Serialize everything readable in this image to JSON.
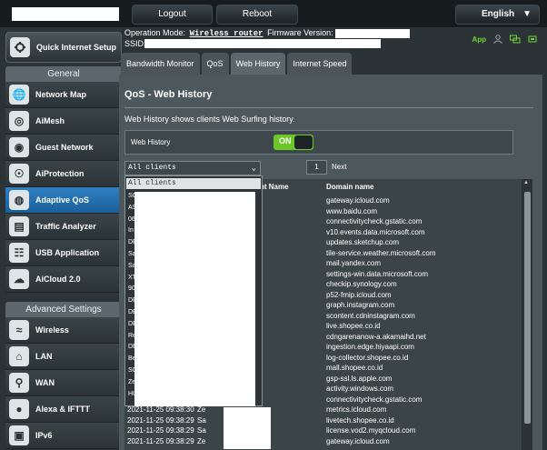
{
  "topbar": {
    "logout_label": "Logout",
    "reboot_label": "Reboot",
    "language": "English"
  },
  "status": {
    "operation_mode_label": "Operation Mode:",
    "operation_mode_value": "Wireless router",
    "firmware_label": "Firmware Version:",
    "ssid_label": "SSID:",
    "app_label": "App"
  },
  "sidebar": {
    "quick_setup_label": "Quick Internet Setup",
    "general_header": "General",
    "general_items": [
      {
        "label": "Network Map",
        "icon": "network-map-icon"
      },
      {
        "label": "AiMesh",
        "icon": "aimesh-icon"
      },
      {
        "label": "Guest Network",
        "icon": "guest-network-icon"
      },
      {
        "label": "AiProtection",
        "icon": "aiprotection-icon"
      },
      {
        "label": "Adaptive QoS",
        "icon": "adaptive-qos-icon"
      },
      {
        "label": "Traffic Analyzer",
        "icon": "traffic-analyzer-icon"
      },
      {
        "label": "USB Application",
        "icon": "usb-application-icon"
      },
      {
        "label": "AiCloud 2.0",
        "icon": "aicloud-icon"
      }
    ],
    "advanced_header": "Advanced Settings",
    "advanced_items": [
      {
        "label": "Wireless",
        "icon": "wireless-icon"
      },
      {
        "label": "LAN",
        "icon": "lan-icon"
      },
      {
        "label": "WAN",
        "icon": "wan-icon"
      },
      {
        "label": "Alexa & IFTTT",
        "icon": "alexa-icon"
      },
      {
        "label": "IPv6",
        "icon": "ipv6-icon"
      }
    ],
    "active_item": "Adaptive QoS"
  },
  "tabs": [
    "Bandwidth Monitor",
    "QoS",
    "Web History",
    "Internet Speed"
  ],
  "active_tab": "Web History",
  "main": {
    "title": "QoS - Web History",
    "description": "Web History shows clients Web Surfing history.",
    "toggle_label": "Web History",
    "toggle_state": "ON",
    "client_filter": "All clients",
    "page_number": "1",
    "next_label": "Next",
    "columns": {
      "client": "nt Name",
      "domain": "Domain name"
    }
  },
  "dropdown": {
    "selected": "All clients",
    "visible_prefixes": [
      "SO",
      "AS",
      "06",
      "In",
      "DE",
      "Sa",
      "Sa",
      "XT",
      "90",
      "DE",
      "DE",
      "DE",
      "Re",
      "DE",
      "Be",
      "SC",
      "Ze",
      "HU"
    ]
  },
  "rows": [
    {
      "time": "",
      "client": "",
      "domain": "gateway.icloud.com"
    },
    {
      "time": "",
      "client": "",
      "domain": "www.baidu.com"
    },
    {
      "time": "",
      "client": "",
      "domain": "connectivitycheck.gstatic.com"
    },
    {
      "time": "",
      "client": "YS",
      "domain": "v10.events.data.microsoft.com"
    },
    {
      "time": "",
      "client": "KE",
      "domain": "updates.sketchup.com"
    },
    {
      "time": "",
      "client": "",
      "domain": "tile-service.weather.microsoft.com"
    },
    {
      "time": "",
      "client": "",
      "domain": "mail.yandex.com"
    },
    {
      "time": "",
      "client": "",
      "domain": "settings-win.data.microsoft.com"
    },
    {
      "time": "",
      "client": "",
      "domain": "checkip.synology.com"
    },
    {
      "time": "",
      "client": "",
      "domain": "p52-fmip.icloud.com"
    },
    {
      "time": "",
      "client": "",
      "domain": "graph.instagram.com"
    },
    {
      "time": "",
      "client": "",
      "domain": "scontent.cdninstagram.com"
    },
    {
      "time": "",
      "client": "9",
      "domain": "live.shopee.co.id"
    },
    {
      "time": "",
      "client": "9",
      "domain": "cdngarenanow-a.akamaihd.net"
    },
    {
      "time": "",
      "client": "9",
      "domain": "ingestion.edge.hiyaapi.com"
    },
    {
      "time": "",
      "client": "9",
      "domain": "log-collector.shopee.co.id"
    },
    {
      "time": "",
      "client": "9",
      "domain": "mall.shopee.co.id"
    },
    {
      "time": "",
      "client": "",
      "domain": "gsp-ssl.ls.apple.com"
    },
    {
      "time": "",
      "client": "U",
      "domain": "activity.windows.com"
    },
    {
      "time": "",
      "client": "",
      "domain": "connectivitycheck.gstatic.com"
    },
    {
      "time": "2021-11-25 09:38:30",
      "client": "Ze",
      "domain": "metrics.icloud.com"
    },
    {
      "time": "2021-11-25 09:38:29",
      "client": "Sa",
      "domain": "livetech.shopee.co.id"
    },
    {
      "time": "2021-11-25 09:38:29",
      "client": "Sa",
      "domain": "license.vod2.myqcloud.com"
    },
    {
      "time": "2021-11-25 09:38:29",
      "client": "Ze",
      "domain": "gateway.icloud.com"
    }
  ],
  "colors": {
    "accent": "#6dc728",
    "active_nav": "#2f7fc0",
    "panel": "#4d585c"
  }
}
